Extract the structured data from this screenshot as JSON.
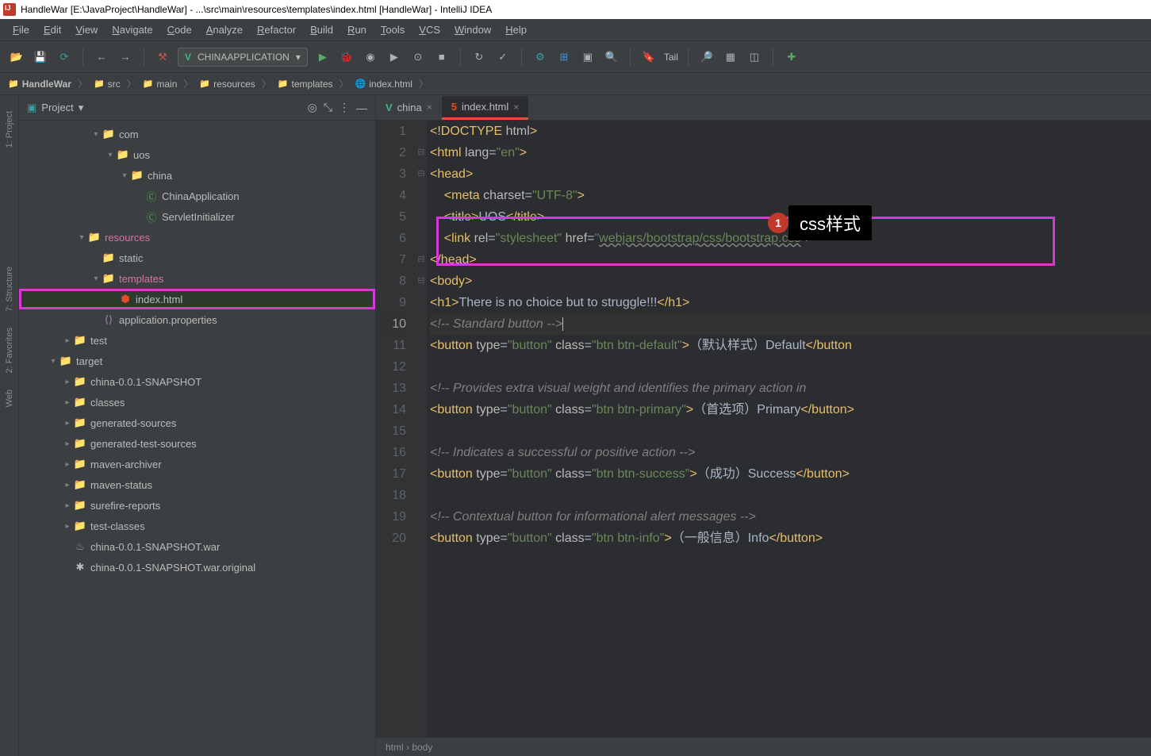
{
  "window": {
    "title": "HandleWar [E:\\JavaProject\\HandleWar] - ...\\src\\main\\resources\\templates\\index.html [HandleWar] - IntelliJ IDEA"
  },
  "menu": {
    "items": [
      "File",
      "Edit",
      "View",
      "Navigate",
      "Code",
      "Analyze",
      "Refactor",
      "Build",
      "Run",
      "Tools",
      "VCS",
      "Window",
      "Help"
    ]
  },
  "toolbar": {
    "run_config": "CHINAAPPLICATION",
    "tail": "Tail"
  },
  "breadcrumbs": [
    {
      "icon": "folder",
      "label": "HandleWar"
    },
    {
      "icon": "folder-blue",
      "label": "src"
    },
    {
      "icon": "folder",
      "label": "main"
    },
    {
      "icon": "folder-red",
      "label": "resources"
    },
    {
      "icon": "folder",
      "label": "templates"
    },
    {
      "icon": "html",
      "label": "index.html"
    }
  ],
  "project_panel": {
    "title": "Project"
  },
  "tree": [
    {
      "indent": 5,
      "arrow": "down",
      "icon": "folder",
      "iconClass": "folder-icon",
      "label": "com"
    },
    {
      "indent": 6,
      "arrow": "down",
      "icon": "folder",
      "iconClass": "folder-icon",
      "label": "uos"
    },
    {
      "indent": 7,
      "arrow": "down",
      "icon": "folder",
      "iconClass": "folder-icon",
      "label": "china"
    },
    {
      "indent": 8,
      "arrow": "",
      "icon": "class",
      "iconClass": "file-green",
      "label": "ChinaApplication"
    },
    {
      "indent": 8,
      "arrow": "",
      "icon": "class",
      "iconClass": "file-green",
      "label": "ServletInitializer"
    },
    {
      "indent": 4,
      "arrow": "down",
      "icon": "folder",
      "iconClass": "folder-red",
      "label": "resources",
      "pink": true
    },
    {
      "indent": 5,
      "arrow": "",
      "icon": "folder",
      "iconClass": "folder-teal",
      "label": "static"
    },
    {
      "indent": 5,
      "arrow": "down",
      "icon": "folder",
      "iconClass": "folder-icon",
      "label": "templates",
      "pink": true,
      "boxed": true
    },
    {
      "indent": 6,
      "arrow": "",
      "icon": "html",
      "iconClass": "file-html",
      "label": "index.html",
      "selected": true
    },
    {
      "indent": 5,
      "arrow": "",
      "icon": "props",
      "iconClass": "file-purple",
      "label": "application.properties"
    },
    {
      "indent": 3,
      "arrow": "right",
      "icon": "folder",
      "iconClass": "folder-teal",
      "label": "test"
    },
    {
      "indent": 2,
      "arrow": "down",
      "icon": "folder",
      "iconClass": "folder-red",
      "label": "target"
    },
    {
      "indent": 3,
      "arrow": "right",
      "icon": "folder",
      "iconClass": "folder-red",
      "label": "china-0.0.1-SNAPSHOT"
    },
    {
      "indent": 3,
      "arrow": "right",
      "icon": "folder",
      "iconClass": "folder-teal",
      "label": "classes"
    },
    {
      "indent": 3,
      "arrow": "right",
      "icon": "folder",
      "iconClass": "folder-red",
      "label": "generated-sources"
    },
    {
      "indent": 3,
      "arrow": "right",
      "icon": "folder",
      "iconClass": "folder-red",
      "label": "generated-test-sources"
    },
    {
      "indent": 3,
      "arrow": "right",
      "icon": "folder",
      "iconClass": "folder-red",
      "label": "maven-archiver"
    },
    {
      "indent": 3,
      "arrow": "right",
      "icon": "folder",
      "iconClass": "folder-red",
      "label": "maven-status"
    },
    {
      "indent": 3,
      "arrow": "right",
      "icon": "folder",
      "iconClass": "folder-red",
      "label": "surefire-reports"
    },
    {
      "indent": 3,
      "arrow": "right",
      "icon": "folder",
      "iconClass": "folder-red",
      "label": "test-classes"
    },
    {
      "indent": 3,
      "arrow": "",
      "icon": "war",
      "iconClass": "file-purple",
      "label": "china-0.0.1-SNAPSHOT.war"
    },
    {
      "indent": 3,
      "arrow": "",
      "icon": "file",
      "iconClass": "",
      "label": "china-0.0.1-SNAPSHOT.war.original"
    }
  ],
  "tabs": [
    {
      "icon": "V",
      "label": "china",
      "active": false
    },
    {
      "icon": "5",
      "label": "index.html",
      "active": true
    }
  ],
  "code": {
    "lines": [
      {
        "n": 1,
        "segs": [
          {
            "t": "<!DOCTYPE ",
            "c": "c-tag"
          },
          {
            "t": "html",
            "c": "c-attr"
          },
          {
            "t": ">",
            "c": "c-tag"
          }
        ]
      },
      {
        "n": 2,
        "fold": "⊟",
        "segs": [
          {
            "t": "<html ",
            "c": "c-tag"
          },
          {
            "t": "lang",
            "c": "c-attr"
          },
          {
            "t": "=",
            "c": "c-text"
          },
          {
            "t": "\"en\"",
            "c": "c-str"
          },
          {
            "t": ">",
            "c": "c-tag"
          }
        ]
      },
      {
        "n": 3,
        "fold": "⊟",
        "segs": [
          {
            "t": "<head>",
            "c": "c-tag"
          }
        ]
      },
      {
        "n": 4,
        "segs": [
          {
            "t": "    <meta ",
            "c": "c-tag"
          },
          {
            "t": "charset",
            "c": "c-attr"
          },
          {
            "t": "=",
            "c": "c-text"
          },
          {
            "t": "\"UTF-8\"",
            "c": "c-str"
          },
          {
            "t": ">",
            "c": "c-tag"
          }
        ]
      },
      {
        "n": 5,
        "segs": [
          {
            "t": "    <title>",
            "c": "c-tag"
          },
          {
            "t": "UOS",
            "c": "c-text"
          },
          {
            "t": "</title>",
            "c": "c-tag"
          }
        ]
      },
      {
        "n": 6,
        "segs": [
          {
            "t": "    <link ",
            "c": "c-tag"
          },
          {
            "t": "rel",
            "c": "c-attr"
          },
          {
            "t": "=",
            "c": "c-text"
          },
          {
            "t": "\"stylesheet\"",
            "c": "c-str"
          },
          {
            "t": " ",
            "c": ""
          },
          {
            "t": "href",
            "c": "c-attr"
          },
          {
            "t": "=",
            "c": "c-text"
          },
          {
            "t": "\"",
            "c": "c-str"
          },
          {
            "t": "webjars/bootstrap/css/bootstrap.css",
            "c": "c-str c-underline"
          },
          {
            "t": "\"",
            "c": "c-str"
          },
          {
            "t": ">",
            "c": "c-tag"
          }
        ]
      },
      {
        "n": 7,
        "fold": "⊟",
        "segs": [
          {
            "t": "</head>",
            "c": "c-tag"
          }
        ]
      },
      {
        "n": 8,
        "fold": "⊟",
        "segs": [
          {
            "t": "<body>",
            "c": "c-tag"
          }
        ]
      },
      {
        "n": 9,
        "segs": [
          {
            "t": "<h1>",
            "c": "c-tag"
          },
          {
            "t": "There is no choice but to struggle!!!",
            "c": "c-text"
          },
          {
            "t": "</h1>",
            "c": "c-tag"
          }
        ]
      },
      {
        "n": 10,
        "cur": true,
        "segs": [
          {
            "t": "<!-- Standard button -->",
            "c": "c-comment"
          }
        ],
        "cursor": true
      },
      {
        "n": 11,
        "segs": [
          {
            "t": "<button ",
            "c": "c-tag"
          },
          {
            "t": "type",
            "c": "c-attr"
          },
          {
            "t": "=",
            "c": "c-text"
          },
          {
            "t": "\"button\"",
            "c": "c-str"
          },
          {
            "t": " ",
            "c": ""
          },
          {
            "t": "class",
            "c": "c-attr"
          },
          {
            "t": "=",
            "c": "c-text"
          },
          {
            "t": "\"btn btn-default\"",
            "c": "c-str"
          },
          {
            "t": ">",
            "c": "c-tag"
          },
          {
            "t": "（默认样式）Default",
            "c": "c-text"
          },
          {
            "t": "</button",
            "c": "c-tag"
          }
        ]
      },
      {
        "n": 12,
        "segs": []
      },
      {
        "n": 13,
        "segs": [
          {
            "t": "<!-- Provides extra visual weight and identifies the primary action in ",
            "c": "c-comment"
          }
        ]
      },
      {
        "n": 14,
        "segs": [
          {
            "t": "<button ",
            "c": "c-tag"
          },
          {
            "t": "type",
            "c": "c-attr"
          },
          {
            "t": "=",
            "c": "c-text"
          },
          {
            "t": "\"button\"",
            "c": "c-str"
          },
          {
            "t": " ",
            "c": ""
          },
          {
            "t": "class",
            "c": "c-attr"
          },
          {
            "t": "=",
            "c": "c-text"
          },
          {
            "t": "\"btn btn-primary\"",
            "c": "c-str"
          },
          {
            "t": ">",
            "c": "c-tag"
          },
          {
            "t": "（首选项）Primary",
            "c": "c-text"
          },
          {
            "t": "</button>",
            "c": "c-tag"
          }
        ]
      },
      {
        "n": 15,
        "segs": []
      },
      {
        "n": 16,
        "segs": [
          {
            "t": "<!-- Indicates a successful or positive action -->",
            "c": "c-comment"
          }
        ]
      },
      {
        "n": 17,
        "segs": [
          {
            "t": "<button ",
            "c": "c-tag"
          },
          {
            "t": "type",
            "c": "c-attr"
          },
          {
            "t": "=",
            "c": "c-text"
          },
          {
            "t": "\"button\"",
            "c": "c-str"
          },
          {
            "t": " ",
            "c": ""
          },
          {
            "t": "class",
            "c": "c-attr"
          },
          {
            "t": "=",
            "c": "c-text"
          },
          {
            "t": "\"btn btn-success\"",
            "c": "c-str"
          },
          {
            "t": ">",
            "c": "c-tag"
          },
          {
            "t": "（成功）Success",
            "c": "c-text"
          },
          {
            "t": "</button>",
            "c": "c-tag"
          }
        ]
      },
      {
        "n": 18,
        "segs": []
      },
      {
        "n": 19,
        "segs": [
          {
            "t": "<!-- Contextual button for informational alert messages -->",
            "c": "c-comment"
          }
        ]
      },
      {
        "n": 20,
        "segs": [
          {
            "t": "<button ",
            "c": "c-tag"
          },
          {
            "t": "type",
            "c": "c-attr"
          },
          {
            "t": "=",
            "c": "c-text"
          },
          {
            "t": "\"button\"",
            "c": "c-str"
          },
          {
            "t": " ",
            "c": ""
          },
          {
            "t": "class",
            "c": "c-attr"
          },
          {
            "t": "=",
            "c": "c-text"
          },
          {
            "t": "\"btn btn-info\"",
            "c": "c-str"
          },
          {
            "t": ">",
            "c": "c-tag"
          },
          {
            "t": "（一般信息）Info",
            "c": "c-text"
          },
          {
            "t": "</button>",
            "c": "c-tag"
          }
        ]
      }
    ]
  },
  "callout": {
    "num": "1",
    "label": "css样式"
  },
  "status": {
    "breadcrumb": "html  ›  body"
  },
  "gutter_labels": {
    "project": "1: Project",
    "structure": "7: Structure",
    "favorites": "2: Favorites",
    "web": "Web"
  }
}
